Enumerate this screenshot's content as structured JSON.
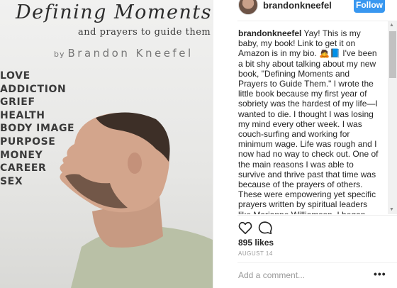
{
  "book": {
    "title": "Defining Moments",
    "subtitle": "and prayers to guide them",
    "author_prefix": "by",
    "author": "Brandon Kneefel",
    "topics": [
      "LOVE",
      "ADDICTION",
      "GRIEF",
      "HEALTH",
      "BODY IMAGE",
      "PURPOSE",
      "MONEY",
      "CAREER",
      "SEX"
    ]
  },
  "post": {
    "username": "brandonkneefel",
    "follow_label": "Follow",
    "caption_user": "brandonkneefel",
    "caption_text": "Yay! This is my baby, my book! Link to get it on Amazon is in my bio. 🙇📘 I've been a bit shy about talking about my new book, \"Defining Moments and Prayers to Guide Them.\" I wrote the little book because my first year of sobriety was the hardest of my life—I wanted to die. I thought I was losing my mind every other week. I was couch-surfing and working for minimum wage. Life was rough and I now had no way to check out. One of the main reasons I was able to survive and thrive past that time was because of the prayers of others. These were empowering yet specific prayers written by spiritual leaders like Marianne Williamson. I began my day with them or turned to them anytime I felt off in a given situation. Soon after I began writing my own prayers to heal my life and relationships. Many of them are included in",
    "likes": "895 likes",
    "date": "AUGUST 14",
    "comment_placeholder": "Add a comment...",
    "more_label": "•••",
    "accent": "#3897f0"
  },
  "icons": [
    "heart-icon",
    "comment-icon",
    "more-options-icon"
  ]
}
